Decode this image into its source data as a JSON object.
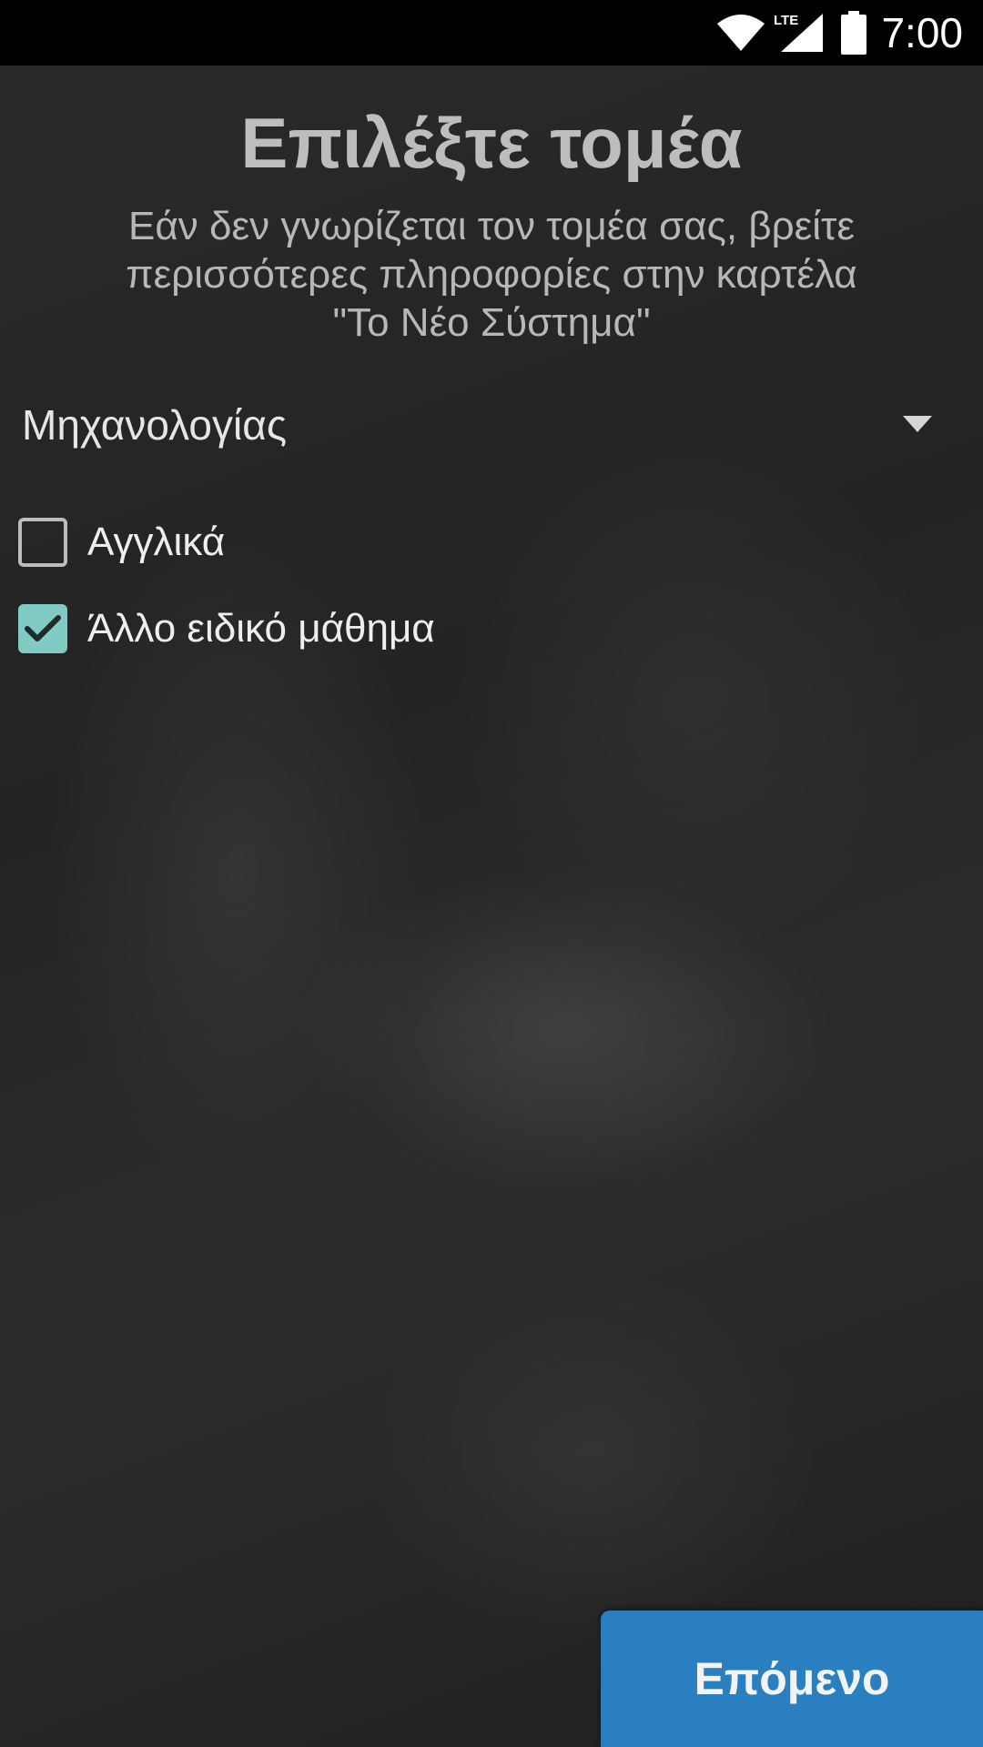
{
  "status_bar": {
    "time": "7:00",
    "network_label": "LTE",
    "icons": [
      "wifi-icon",
      "lte-signal-icon",
      "battery-icon"
    ]
  },
  "header": {
    "title": "Επιλέξτε τομέα",
    "subtitle_lines": [
      "Εάν δεν γνωρίζεται τον τομέα σας, βρείτε",
      "περισσότερες πληροφορίες στην καρτέλα",
      "\"Το Νέο Σύστημα\""
    ]
  },
  "sector_spinner": {
    "selected": "Μηχανολογίας",
    "icon": "dropdown-arrow-icon"
  },
  "options": [
    {
      "label": "Αγγλικά",
      "checked": false
    },
    {
      "label": "Άλλο ειδικό μάθημα",
      "checked": true
    }
  ],
  "footer": {
    "next_label": "Επόμενο"
  },
  "colors": {
    "status_bar": "#000000",
    "checkbox_checked": "#80cbc4",
    "next_button": "#2a7fc0",
    "title_text": "#bdbdbd"
  }
}
